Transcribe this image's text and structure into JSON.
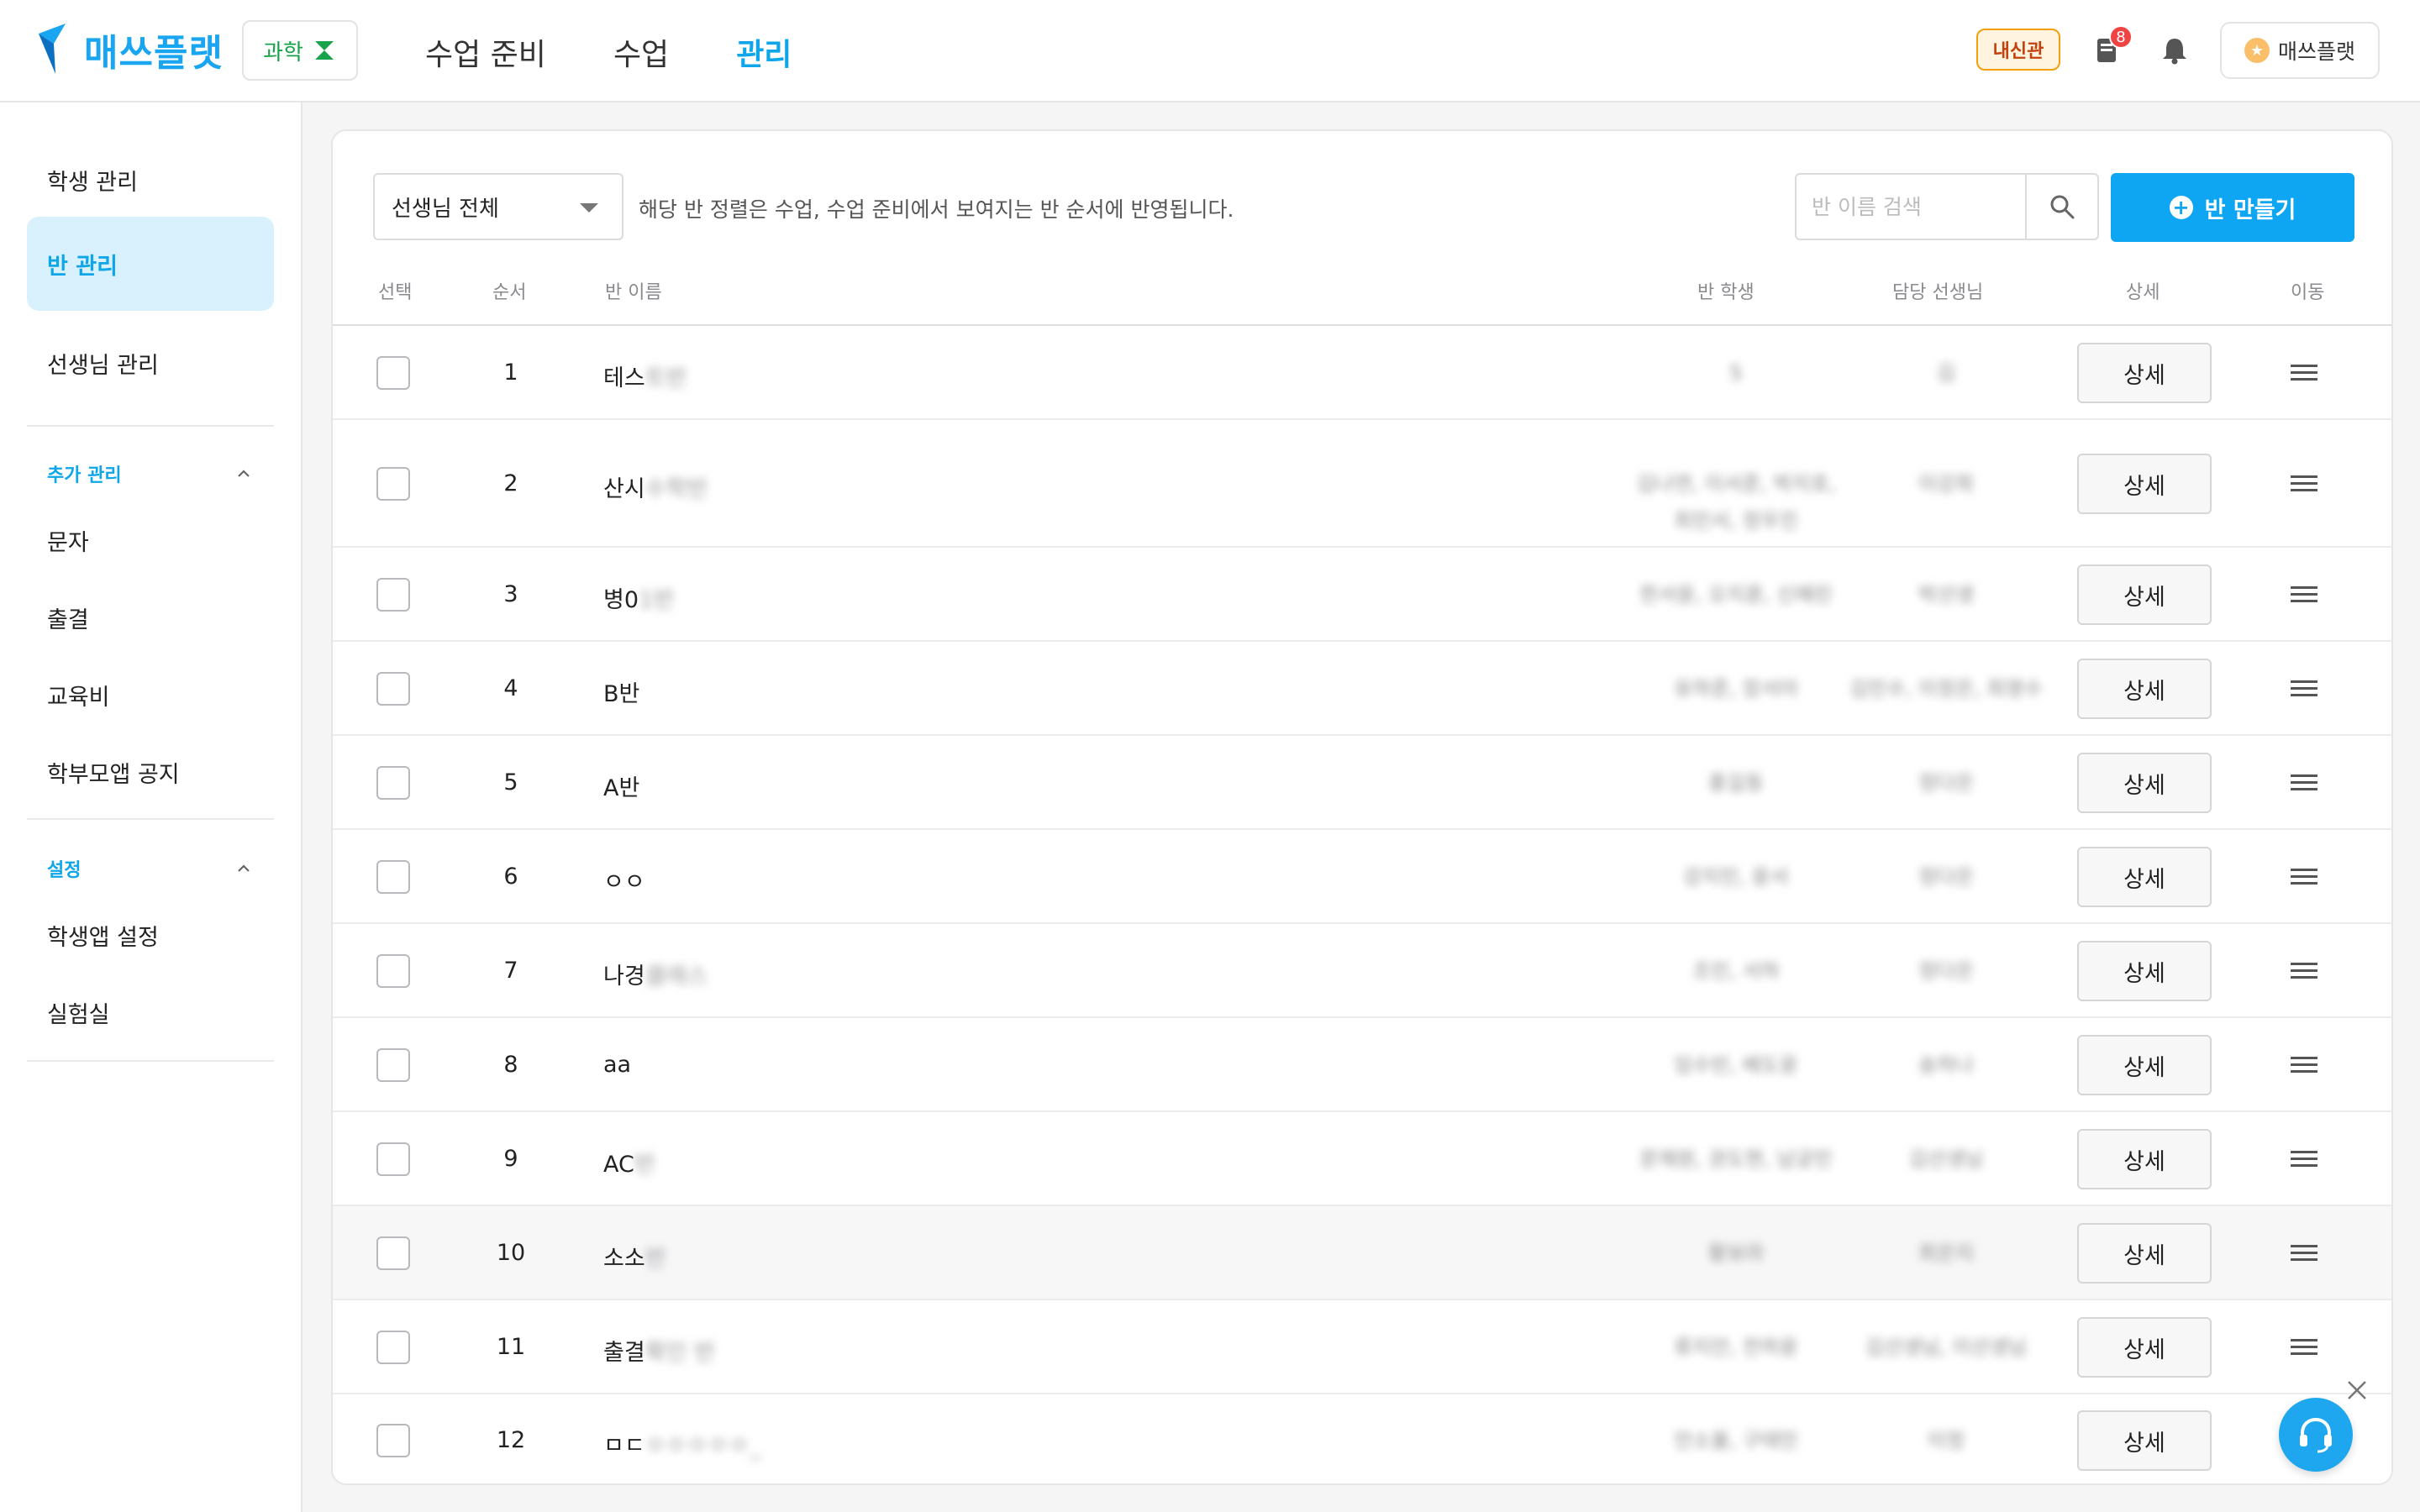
{
  "brand": {
    "name": "매쓰플랫",
    "accent": "#1aa5f0"
  },
  "subject": {
    "label": "과학",
    "icon": "hourglass-icon"
  },
  "topnav": [
    {
      "label": "수업 준비",
      "active": false
    },
    {
      "label": "수업",
      "active": false
    },
    {
      "label": "관리",
      "active": true
    }
  ],
  "header": {
    "naesin_badge": "내신관",
    "notification_count": "8",
    "profile_label": "매쓰플랫"
  },
  "sidebar": {
    "items": [
      {
        "label": "학생 관리",
        "active": false
      },
      {
        "label": "반 관리",
        "active": true
      },
      {
        "label": "선생님 관리",
        "active": false
      }
    ],
    "extra_section": {
      "title": "추가 관리",
      "items": [
        "문자",
        "출결",
        "교육비",
        "학부모앱 공지"
      ]
    },
    "settings_section": {
      "title": "설정",
      "items": [
        "학생앱 설정",
        "실험실"
      ]
    }
  },
  "toolbar": {
    "teacher_filter": "선생님 전체",
    "sort_hint": "해당 반 정렬은 수업, 수업 준비에서 보여지는 반 순서에 반영됩니다.",
    "search_placeholder": "반 이름 검색",
    "create_label": "반 만들기"
  },
  "table": {
    "headers": {
      "select": "선택",
      "order": "순서",
      "name": "반 이름",
      "students": "반 학생",
      "teacher": "담당 선생님",
      "detail": "상세",
      "move": "이동"
    },
    "detail_label": "상세",
    "rows": [
      {
        "order": "1",
        "name_visible": "테스",
        "name_hidden": "트반",
        "students": "5",
        "teacher": "김"
      },
      {
        "order": "2",
        "name_visible": "산시",
        "name_hidden": "수학반",
        "students": "김나연, 이서준, 박지호, 최민서, 정우진",
        "teacher": "이강희"
      },
      {
        "order": "3",
        "name_visible": "병0",
        "name_hidden": "1반",
        "students": "한서윤, 오지훈, 신예린",
        "teacher": "박선생"
      },
      {
        "order": "4",
        "name_visible": "B반",
        "name_hidden": "",
        "students": "유하준, 장서아",
        "teacher": "김민수, 이정은, 최영수"
      },
      {
        "order": "5",
        "name_visible": "A반",
        "name_hidden": "",
        "students": "홍길동",
        "teacher": "정다은"
      },
      {
        "order": "6",
        "name_visible": "ㅇㅇ",
        "name_hidden": "",
        "students": "강지민, 윤서",
        "teacher": "정다은"
      },
      {
        "order": "7",
        "name_visible": "나경",
        "name_hidden": "클래스",
        "students": "조민, 서하",
        "teacher": "정다은"
      },
      {
        "order": "8",
        "name_visible": "aa",
        "name_hidden": "",
        "students": "임수빈, 배도윤",
        "teacher": "송하나"
      },
      {
        "order": "9",
        "name_visible": "AC",
        "name_hidden": "반",
        "students": "문채원, 권도현, 남궁민",
        "teacher": "김선생님"
      },
      {
        "order": "10",
        "name_visible": "소소",
        "name_hidden": "반",
        "students": "황보라",
        "teacher": "최은지"
      },
      {
        "order": "11",
        "name_visible": "출결",
        "name_hidden": "확인 반",
        "students": "류지안, 전하윤",
        "teacher": "김선생님, 이선생님"
      },
      {
        "order": "12",
        "name_visible": "ㅁㄷ",
        "name_hidden": "ㅇㅇㅇㅇㅇ_",
        "students": "안소율, 구태민",
        "teacher": "이정"
      }
    ]
  }
}
